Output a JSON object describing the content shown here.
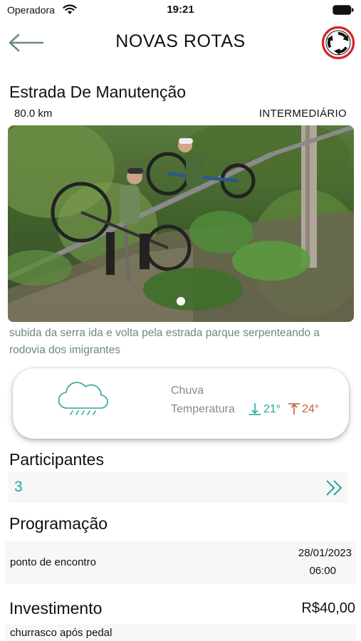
{
  "status_bar": {
    "carrier": "Operadora",
    "time": "19:21",
    "icons": [
      "wifi-icon",
      "battery-icon"
    ]
  },
  "header": {
    "title": "NOVAS ROTAS",
    "back_icon": "arrow-left-icon",
    "action_icon": "circular-arrows-icon"
  },
  "route": {
    "name": "Estrada De Manutenção",
    "distance": "80.0 km",
    "difficulty": "INTERMEDIÁRIO",
    "description": "subida da serra ida e volta pela estrada parque serpenteando a rodovia dos imigrantes",
    "photo_index": 1,
    "photo_count": 1
  },
  "weather": {
    "icon": "cloud-rain-icon",
    "condition": "Chuva",
    "temperature_label": "Temperatura",
    "min": "21°",
    "max": "24°"
  },
  "participants": {
    "title": "Participantes",
    "count": "3",
    "chevron_icon": "double-chevron-right-icon"
  },
  "schedule": {
    "title": "Programação",
    "items": [
      {
        "label": "ponto de encontro",
        "date": "28/01/2023",
        "time": "06:00"
      }
    ]
  },
  "investment": {
    "title": "Investimento",
    "price": "R$40,00",
    "description": "churrasco após pedal"
  },
  "colors": {
    "accent_teal": "#2aa59a",
    "description_green": "#6e8a79",
    "temp_max": "#c0603b",
    "icon_red": "#d8222a",
    "back_arrow": "#6b8f78"
  }
}
